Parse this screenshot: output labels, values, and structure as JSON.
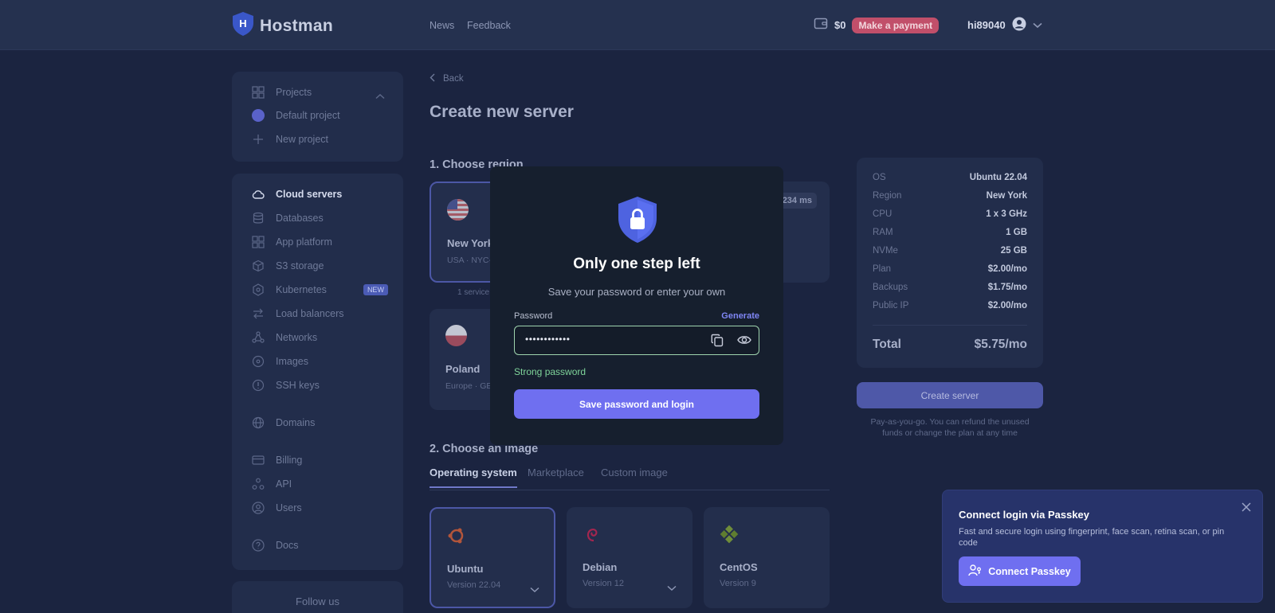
{
  "brand": {
    "name": "Hostman",
    "logo_letter": "H"
  },
  "nav": {
    "news": "News",
    "feedback": "Feedback"
  },
  "wallet": {
    "balance": "$0",
    "pay_label": "Make a payment"
  },
  "user": {
    "name": "hi89040"
  },
  "projects": {
    "header": "Projects",
    "items": [
      {
        "label": "Default project"
      },
      {
        "label": "New project"
      }
    ]
  },
  "sidebar": {
    "items": [
      {
        "label": "Cloud servers",
        "icon": "cloud-icon"
      },
      {
        "label": "Databases",
        "icon": "database-icon"
      },
      {
        "label": "App platform",
        "icon": "grid-icon"
      },
      {
        "label": "S3 storage",
        "icon": "cube-icon"
      },
      {
        "label": "Kubernetes",
        "icon": "kubernetes-icon",
        "badge": "NEW"
      },
      {
        "label": "Load balancers",
        "icon": "arrows-icon"
      },
      {
        "label": "Networks",
        "icon": "network-icon"
      },
      {
        "label": "Images",
        "icon": "disc-icon"
      },
      {
        "label": "SSH keys",
        "icon": "key-icon"
      },
      {
        "label": "Domains",
        "icon": "globe-icon"
      },
      {
        "label": "Billing",
        "icon": "card-icon"
      },
      {
        "label": "API",
        "icon": "api-icon"
      },
      {
        "label": "Users",
        "icon": "user-icon"
      },
      {
        "label": "Docs",
        "icon": "help-icon"
      }
    ],
    "follow_us": "Follow us"
  },
  "main": {
    "back": "Back",
    "title": "Create new server",
    "section1": "1. Choose region",
    "regions": [
      {
        "name": "New York",
        "sub": "USA · NYC-",
        "note": "1 service l"
      },
      {
        "name": "Poland",
        "sub": "Europe · GE"
      }
    ],
    "ping": "234 ms",
    "section2": "2. Choose an image",
    "image_tabs": [
      "Operating system",
      "Marketplace",
      "Custom image"
    ],
    "os": [
      {
        "name": "Ubuntu",
        "version": "Version 22.04"
      },
      {
        "name": "Debian",
        "version": "Version 12"
      },
      {
        "name": "CentOS",
        "version": "Version 9"
      }
    ]
  },
  "summary": {
    "rows": [
      {
        "k": "OS",
        "v": "Ubuntu 22.04"
      },
      {
        "k": "Region",
        "v": "New York"
      },
      {
        "k": "CPU",
        "v": "1 x 3 GHz"
      },
      {
        "k": "RAM",
        "v": "1 GB"
      },
      {
        "k": "NVMe",
        "v": "25 GB"
      },
      {
        "k": "Plan",
        "v": "$2.00/mo"
      },
      {
        "k": "Backups",
        "v": "$1.75/mo"
      },
      {
        "k": "Public IP",
        "v": "$2.00/mo"
      }
    ],
    "total_label": "Total",
    "total_value": "$5.75/mo",
    "create_label": "Create server",
    "note_line1": "Pay-as-you-go. You can refund the unused",
    "note_line2": "funds or change the plan at any time"
  },
  "modal": {
    "title": "Only one step left",
    "subtitle": "Save your password or enter your own",
    "password_label": "Password",
    "generate_label": "Generate",
    "password_value": "••••••••••••",
    "strength": "Strong password",
    "save_label": "Save password and login"
  },
  "passkey": {
    "title": "Connect login via Passkey",
    "desc": "Fast and secure login using fingerprint, face scan, retina scan, or pin code",
    "button": "Connect Passkey"
  },
  "colors": {
    "accent": "#6f6ff0",
    "pay": "#c14f6a",
    "strong": "#7fd49a"
  }
}
